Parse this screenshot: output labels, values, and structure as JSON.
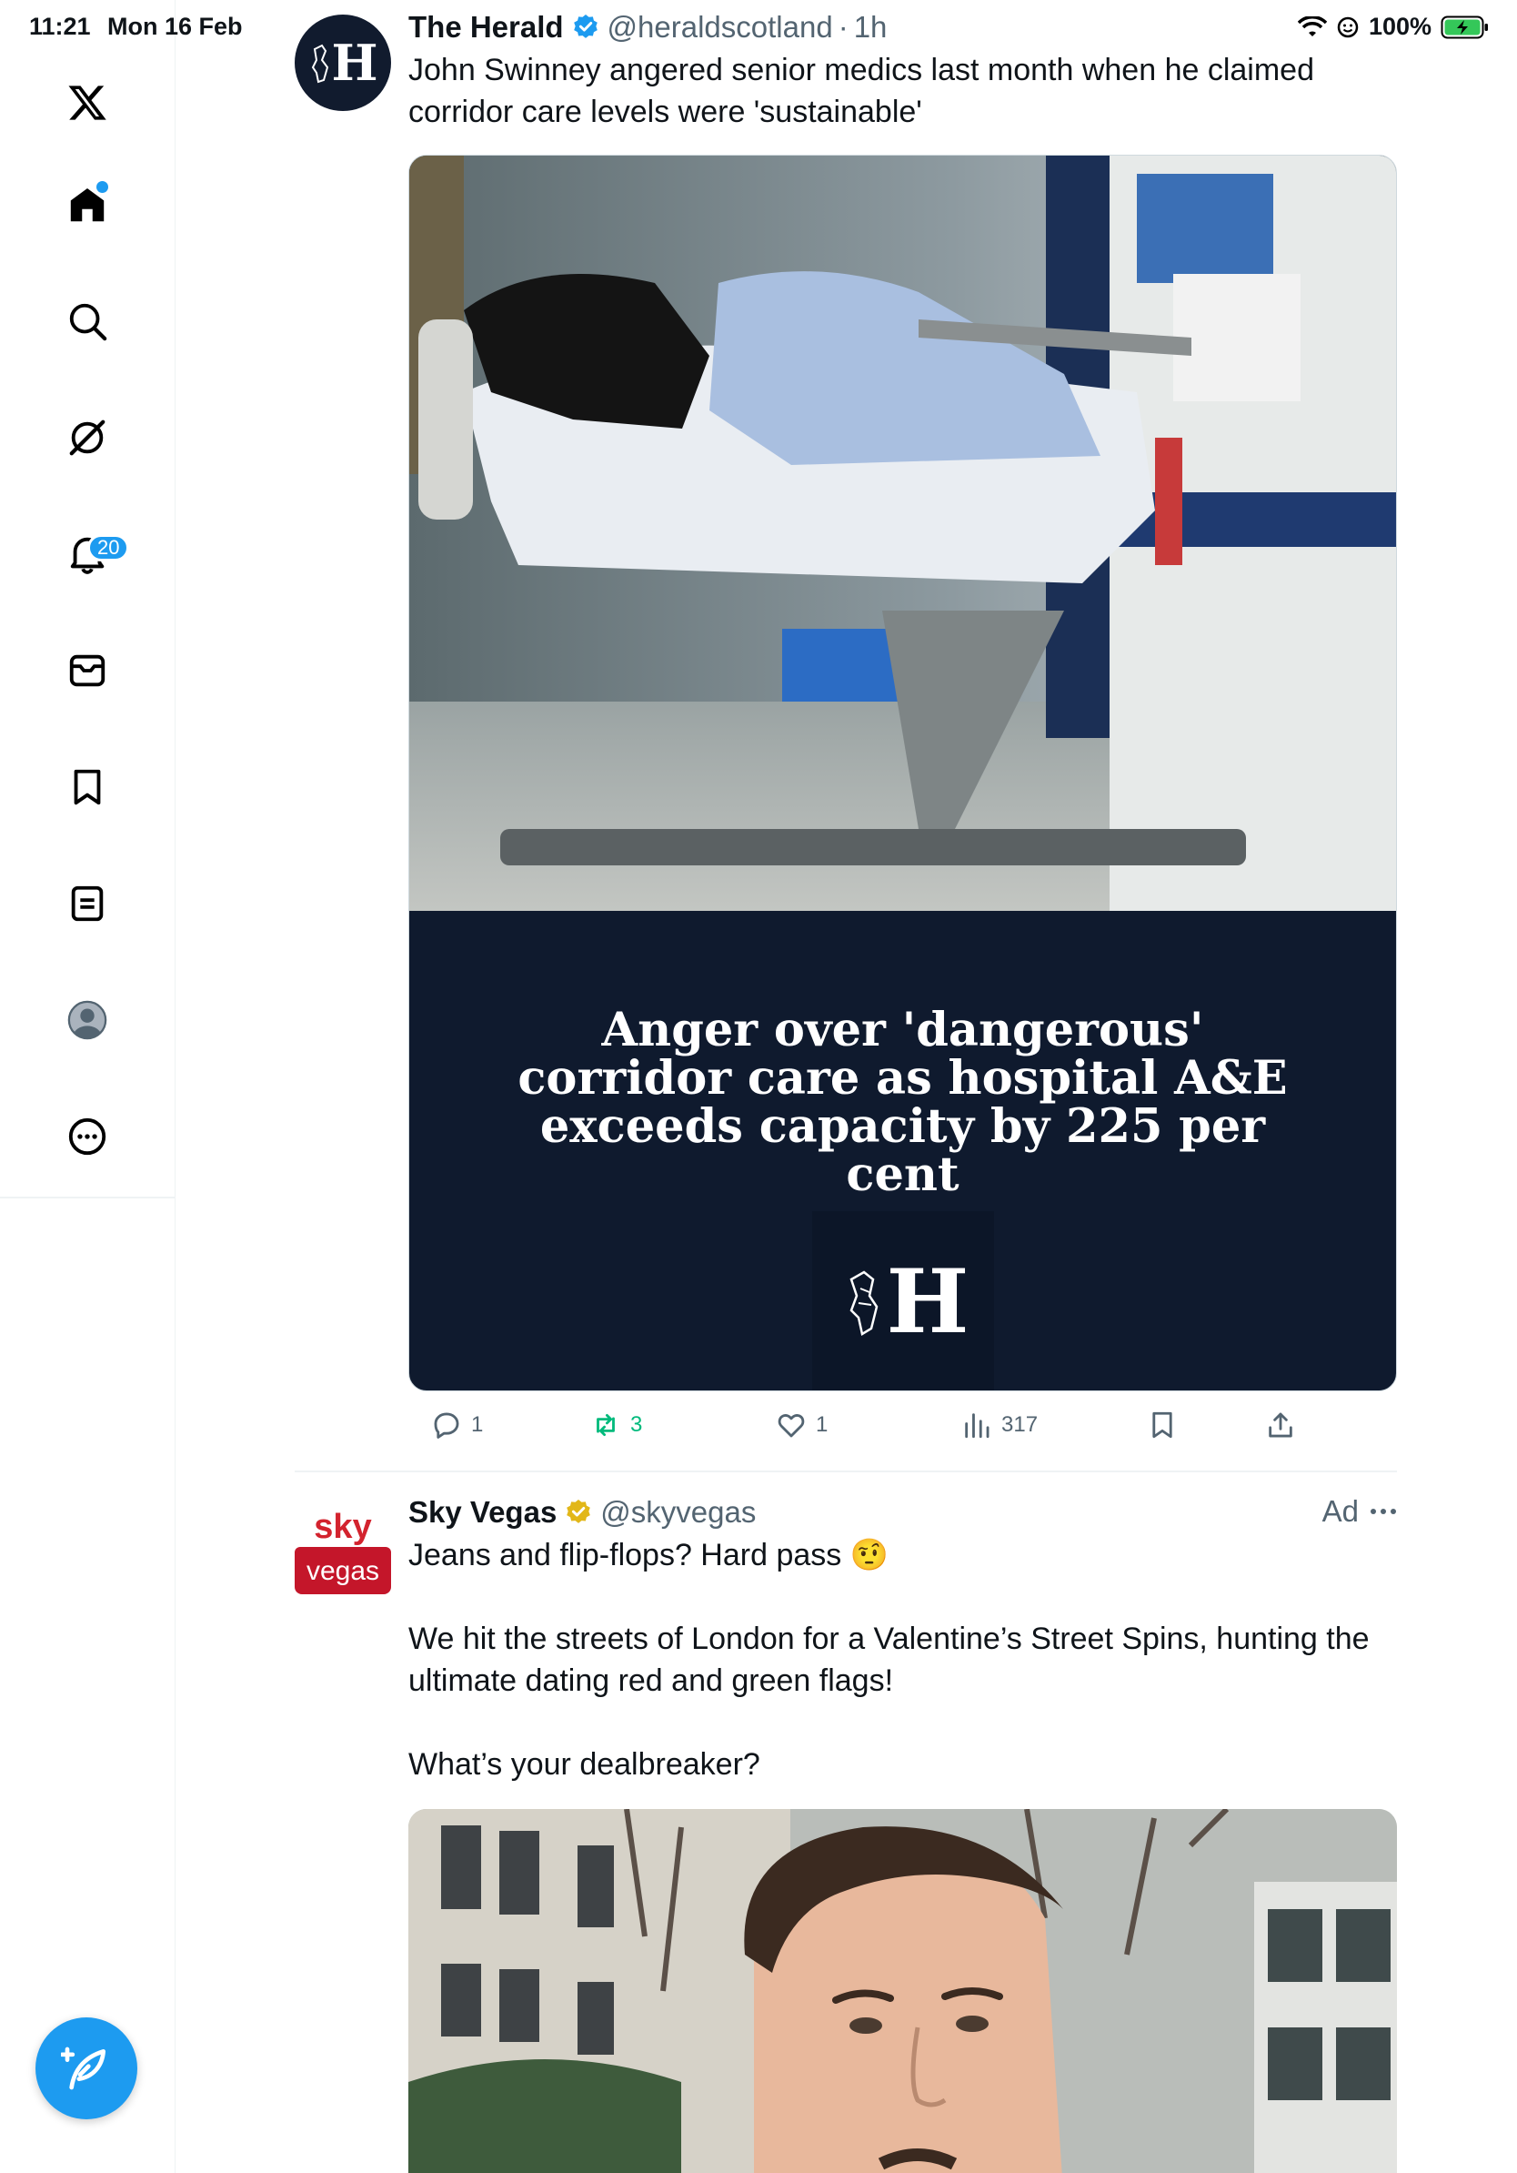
{
  "status": {
    "time": "11:21",
    "date": "Mon 16 Feb",
    "battery": "100%"
  },
  "sidebar": {
    "items": [
      {
        "name": "x-logo-icon"
      },
      {
        "name": "home-icon"
      },
      {
        "name": "search-icon"
      },
      {
        "name": "grok-icon"
      },
      {
        "name": "notifications-icon",
        "badge": "20"
      },
      {
        "name": "messages-icon"
      },
      {
        "name": "bookmarks-icon"
      },
      {
        "name": "lists-icon"
      },
      {
        "name": "profile-icon"
      },
      {
        "name": "more-icon"
      }
    ],
    "compose_icon": "compose-feather-icon"
  },
  "tweets": [
    {
      "avatar_letter": "H",
      "name": "The Herald",
      "handle": "@heraldscotland",
      "time": "1h",
      "text": "John Swinney angered senior medics last month when he claimed corridor care levels were 'sustainable'",
      "card": {
        "headline": "Anger over 'dangerous' corridor care as hospital A&E exceeds capacity by 225 per cent",
        "logo_letter": "H"
      },
      "stats": {
        "replies": "1",
        "reposts": "3",
        "likes": "1",
        "views": "317"
      }
    },
    {
      "avatar_text_top": "sky",
      "avatar_text_bottom": "vegas",
      "name": "Sky Vegas",
      "handle": "@skyvegas",
      "ad_label": "Ad",
      "text": "Jeans and flip-flops? Hard pass 🤨\n\nWe hit the streets of London for a Valentine’s Street Spins, hunting the ultimate dating red and green flags!\n\nWhat’s your dealbreaker?"
    }
  ],
  "colors": {
    "accent": "#1d9bf0",
    "repost": "#00ba7c",
    "card_bg": "#0f1a2e",
    "sky_red": "#d3232e"
  }
}
